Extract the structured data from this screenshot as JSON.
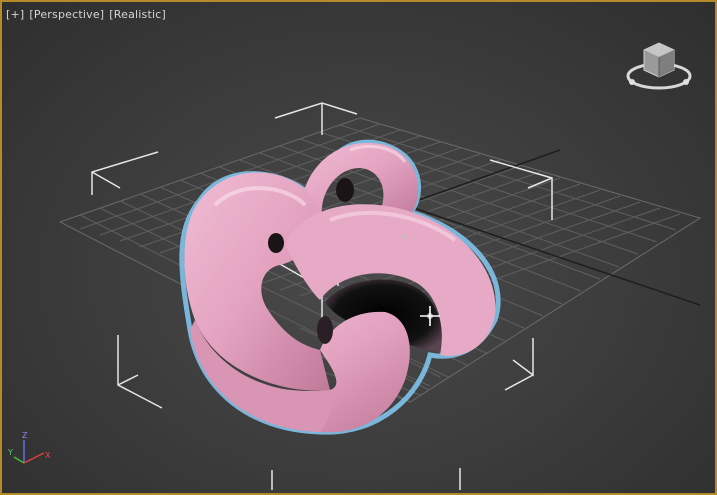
{
  "viewport": {
    "labels": [
      "[+]",
      "[Perspective]",
      "[Realistic]"
    ],
    "type": "3D viewport",
    "active_border_color": "#b58a2a",
    "background_color": "#3c3c3c",
    "object": {
      "shape": "torus knot",
      "color": "#e3a3c0",
      "selection_outline_color": "#7fc3ea"
    },
    "gizmo_axes": [
      "Z",
      "Y",
      "X"
    ],
    "viewcube_icon": "viewcube-icon",
    "cursor_icon": "move-cursor-icon"
  }
}
